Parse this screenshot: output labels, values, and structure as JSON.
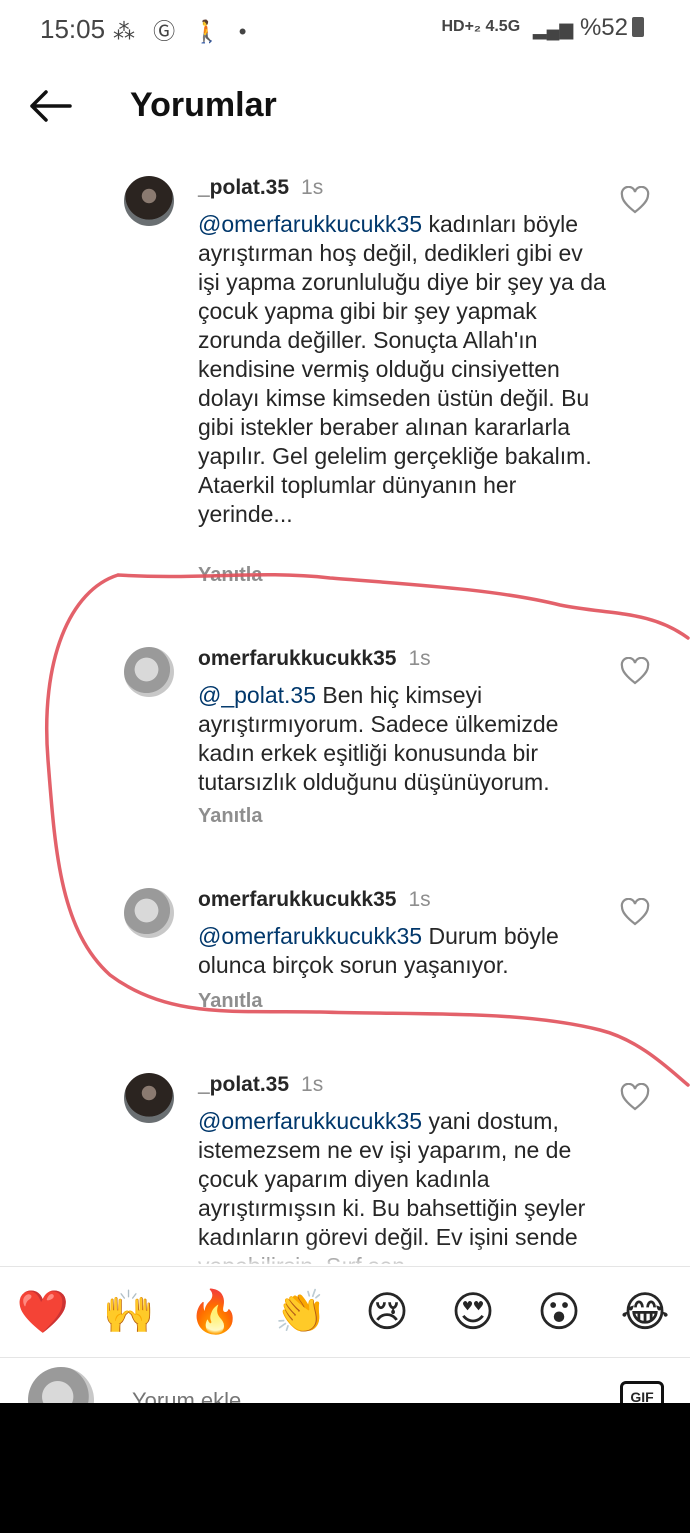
{
  "status_bar": {
    "time": "15:05",
    "network": "HD+₂ 4.5G",
    "battery": "%52"
  },
  "header": {
    "title": "Yorumlar"
  },
  "comments": [
    {
      "username": "_polat.35",
      "time": "1s",
      "mention": "@omerfarukkucukk35",
      "text": " kadınları böyle ayrıştırman hoş değil, dedikleri gibi ev işi yapma zorunluluğu diye bir şey ya da çocuk yapma gibi bir şey yapmak zorunda değiller. Sonuçta Allah'ın kendisine vermiş olduğu cinsiyetten dolayı kimse kimseden üstün değil. Bu gibi istekler beraber alınan kararlarla yapılır. Gel gelelim gerçekliğe bakalım. Ataerkil toplumlar dünyanın her yerinde...",
      "reply_label": "Yanıtla"
    },
    {
      "username": "omerfarukkucukk35",
      "time": "1s",
      "mention": "@_polat.35",
      "text": " Ben hiç kimseyi ayrıştırmıyorum. Sadece ülkemizde kadın erkek eşitliği konusunda bir tutarsızlık olduğunu düşünüyorum.",
      "reply_label": "Yanıtla"
    },
    {
      "username": "omerfarukkucukk35",
      "time": "1s",
      "mention": "@omerfarukkucukk35",
      "text": " Durum böyle olunca birçok sorun yaşanıyor.",
      "reply_label": "Yanıtla"
    },
    {
      "username": "_polat.35",
      "time": "1s",
      "mention": "@omerfarukkucukk35",
      "text": " yani dostum, istemezsem ne ev işi yaparım, ne de çocuk yaparım diyen kadınla ayrıştırmışsın ki. Bu bahsettiğin şeyler kadınların görevi değil. Ev işini sende yapabilirsin. Sırf sen",
      "reply_label": ""
    }
  ],
  "emoji_bar": [
    "❤️",
    "🙌",
    "🔥",
    "👏",
    "😢",
    "😍",
    "😮",
    "😂"
  ],
  "comment_input": {
    "placeholder": "Yorum ekle..."
  },
  "gif_label": "GIF",
  "colors": {
    "mention": "#00376b",
    "annotation_stroke": "#e0505a"
  }
}
